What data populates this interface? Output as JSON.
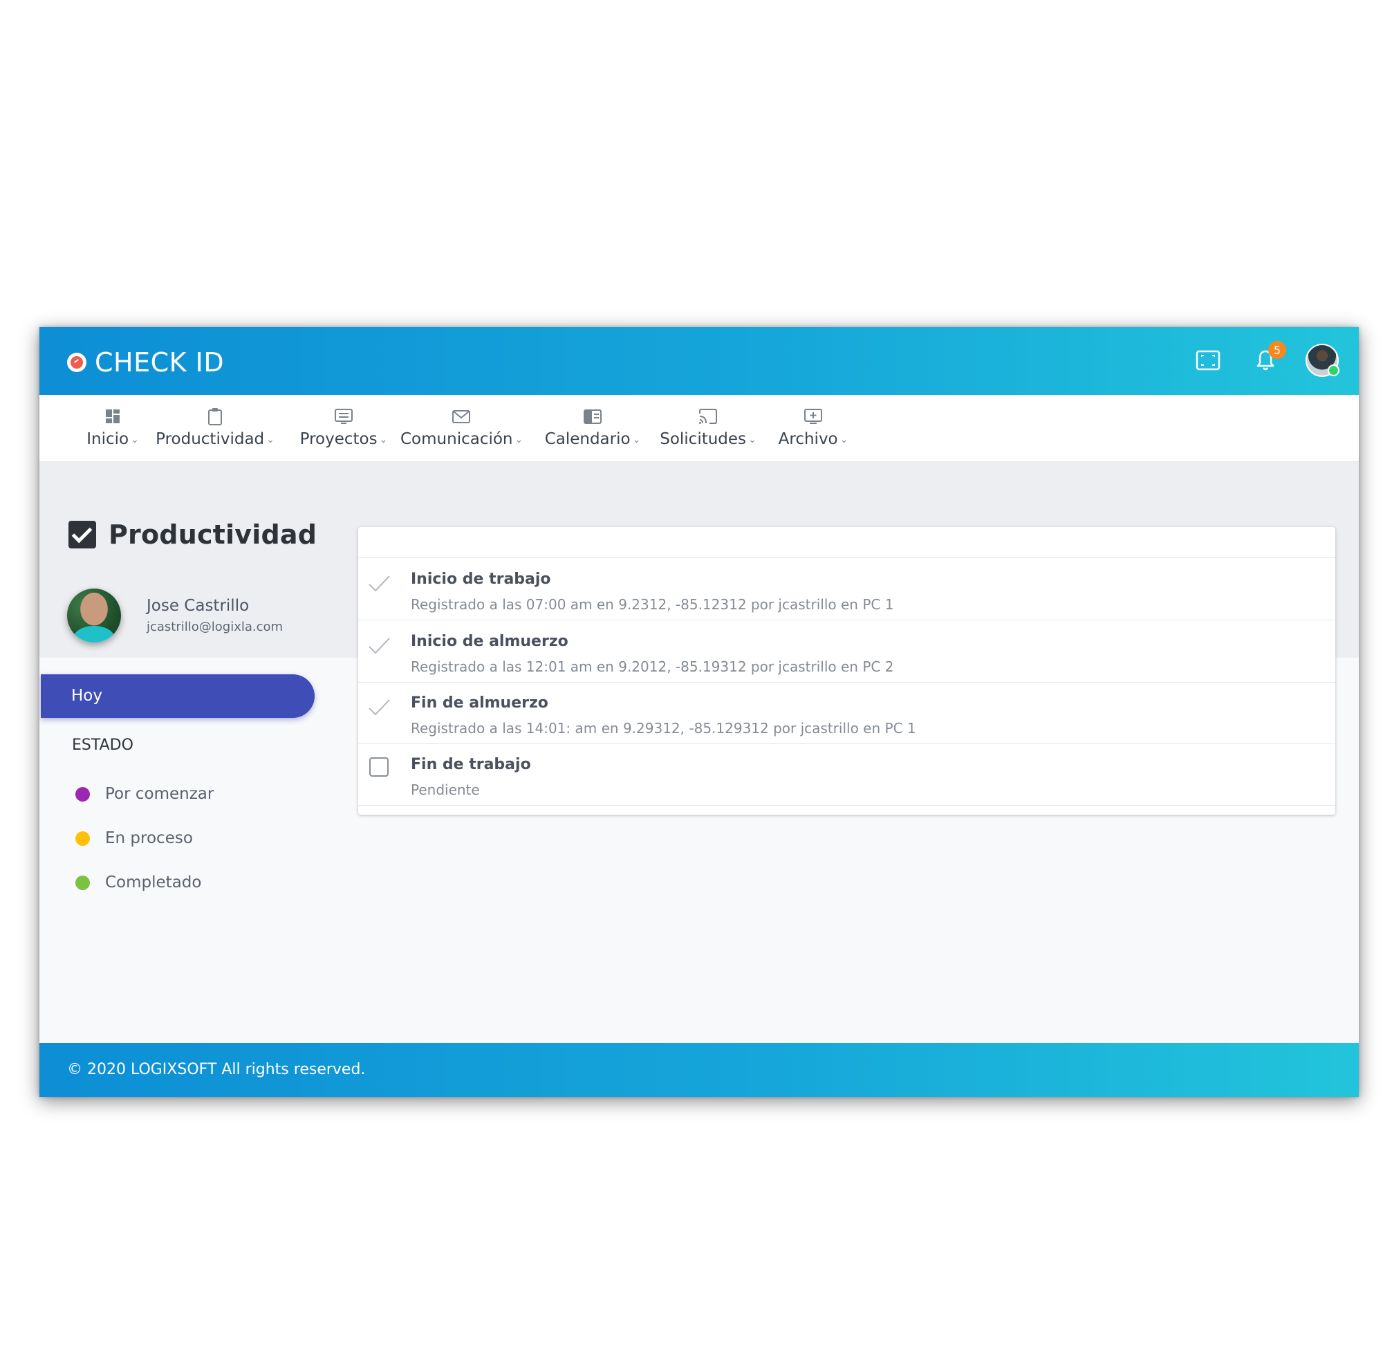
{
  "app": {
    "title": "CHECK ID",
    "notifications_count": "5"
  },
  "menu": [
    {
      "label": "Inicio",
      "icon": "dashboard-icon"
    },
    {
      "label": "Productividad",
      "icon": "clipboard-icon"
    },
    {
      "label": "Proyectos",
      "icon": "list-board-icon"
    },
    {
      "label": "Comunicación",
      "icon": "mail-icon"
    },
    {
      "label": "Calendario",
      "icon": "calendar-icon"
    },
    {
      "label": "Solicitudes",
      "icon": "cast-icon"
    },
    {
      "label": "Archivo",
      "icon": "add-monitor-icon"
    }
  ],
  "page": {
    "title": "Productividad"
  },
  "profile": {
    "name": "Jose Castrillo",
    "email": "jcastrillo@logixla.com"
  },
  "sidebar": {
    "active_item": "Hoy",
    "estado_heading": "ESTADO",
    "statuses": [
      {
        "label": "Por comenzar",
        "color": "#9c27b0"
      },
      {
        "label": "En proceso",
        "color": "#ffc107"
      },
      {
        "label": "Completado",
        "color": "#7cc242"
      }
    ]
  },
  "tasks": [
    {
      "title": "Inicio de trabajo",
      "detail": "Registrado a las 07:00 am en 9.2312, -85.12312 por jcastrillo en PC 1",
      "done": true
    },
    {
      "title": "Inicio de almuerzo",
      "detail": "Registrado a las 12:01 am en 9.2012, -85.19312 por jcastrillo en PC 2",
      "done": true
    },
    {
      "title": "Fin de almuerzo",
      "detail": "Registrado a las 14:01: am en 9.29312, -85.129312 por jcastrillo en PC 1",
      "done": true
    },
    {
      "title": "Fin de trabajo",
      "detail": "Pendiente",
      "done": false
    }
  ],
  "footer": {
    "text": "© 2020 LOGIXSOFT All rights reserved."
  },
  "colors": {
    "header_gradient_start": "#0d8ed5",
    "header_gradient_end": "#22c4db",
    "active_nav": "#3f4db7",
    "badge": "#f5891f"
  }
}
